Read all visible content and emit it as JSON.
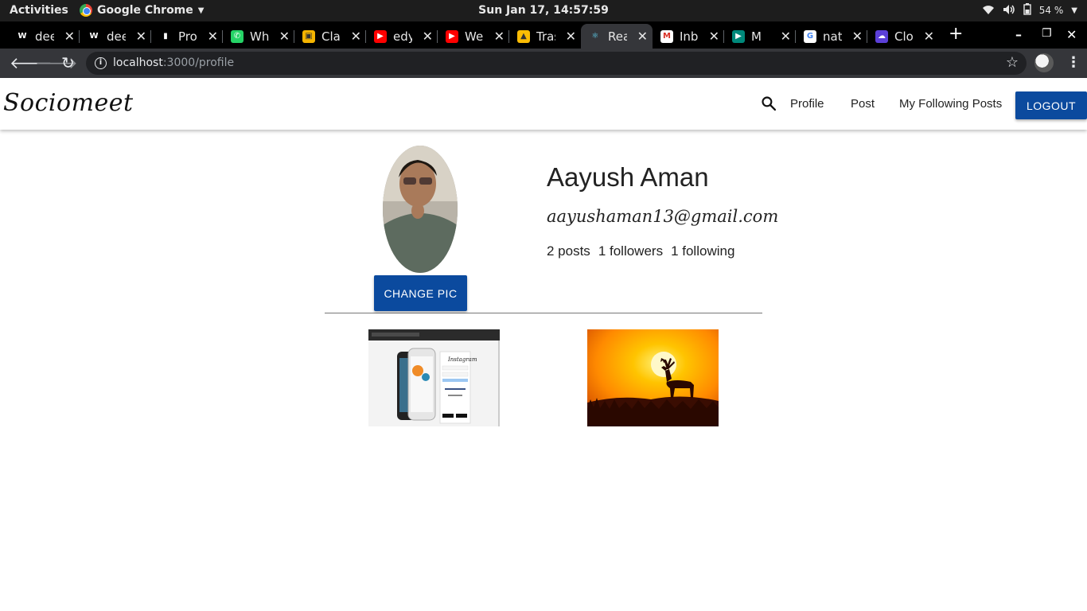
{
  "os": {
    "activities": "Activities",
    "app_name": "Google Chrome",
    "clock": "Sun Jan 17, 14:57:59",
    "battery": "54 %"
  },
  "tabs": [
    {
      "label": "deep",
      "icon": "w-icon",
      "fav_color": "#000000",
      "fav_text": "W"
    },
    {
      "label": "deep",
      "icon": "w-icon",
      "fav_color": "#000000",
      "fav_text": "W"
    },
    {
      "label": "Prof",
      "icon": "bar-chart-icon",
      "fav_color": "#000000",
      "fav_text": "▮"
    },
    {
      "label": "What",
      "icon": "whatsapp-icon",
      "fav_color": "#25d366",
      "fav_text": "✆"
    },
    {
      "label": "Class",
      "icon": "classroom-icon",
      "fav_color": "#f4b400",
      "fav_text": "▣"
    },
    {
      "label": "edyt",
      "icon": "youtube-icon",
      "fav_color": "#ff0000",
      "fav_text": "▶"
    },
    {
      "label": "Wei",
      "icon": "youtube-icon",
      "fav_color": "#ff0000",
      "fav_text": "▶"
    },
    {
      "label": "Tras",
      "icon": "drive-icon",
      "fav_color": "#fbbc04",
      "fav_text": "▲"
    },
    {
      "label": "Rea",
      "icon": "react-icon",
      "fav_color": "#35363a",
      "fav_text": "⚛"
    },
    {
      "label": "Inbo",
      "icon": "gmail-icon",
      "fav_color": "#ffffff",
      "fav_text": "M"
    },
    {
      "label": "M",
      "icon": "meet-icon",
      "fav_color": "#00897b",
      "fav_text": "▶"
    },
    {
      "label": "natu",
      "icon": "google-icon",
      "fav_color": "#ffffff",
      "fav_text": "G"
    },
    {
      "label": "Clou",
      "icon": "cloud-icon",
      "fav_color": "#5b3fd8",
      "fav_text": "☁"
    }
  ],
  "browser": {
    "url_host": "localhost",
    "url_path": ":3000/profile"
  },
  "nav": {
    "brand": "Sociomeet",
    "links": [
      "Profile",
      "Post",
      "My Following Posts"
    ],
    "logout": "LOGOUT"
  },
  "profile": {
    "name": "Aayush Aman",
    "email": "aayushaman13@gmail.com",
    "posts": "2 posts",
    "followers": "1 followers",
    "following": "1 following",
    "change_pic": "CHANGE PIC"
  },
  "posts": [
    {
      "name": "instagram-screenshot-post",
      "alt": "instagram clone screenshot"
    },
    {
      "name": "deer-sunset-post",
      "alt": "deer at sunset"
    }
  ],
  "colors": {
    "primary": "#0b4a9e",
    "chrome_dark": "#35363a"
  }
}
